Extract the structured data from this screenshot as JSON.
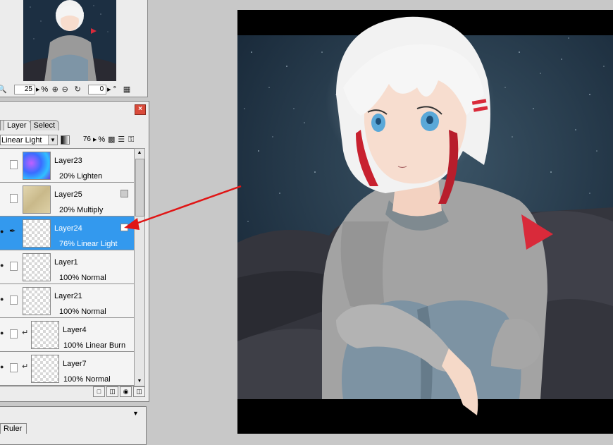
{
  "navigator": {
    "zoom_value": "25",
    "zoom_unit": "%",
    "rotation_value": "0",
    "rotation_unit": "°"
  },
  "layer_panel": {
    "tabs": [
      {
        "label": "Layer",
        "active": true
      },
      {
        "label": "Select",
        "active": false
      }
    ],
    "blend_mode": "Linear Light",
    "opacity_value": "76",
    "opacity_unit": "%",
    "layers": [
      {
        "name": "Layer23",
        "mode": "20% Lighten",
        "thumb": "galaxy",
        "visible": false,
        "selected": false,
        "clipped": false,
        "mask": false
      },
      {
        "name": "Layer25",
        "mode": "20% Multiply",
        "thumb": "paper",
        "visible": false,
        "selected": false,
        "clipped": false,
        "mask": true
      },
      {
        "name": "Layer24",
        "mode": "76% Linear Light",
        "thumb": "empty",
        "visible": true,
        "selected": true,
        "clipped": false,
        "mask": true
      },
      {
        "name": "Layer1",
        "mode": "100% Normal",
        "thumb": "empty",
        "visible": true,
        "selected": false,
        "clipped": false,
        "mask": false
      },
      {
        "name": "Layer21",
        "mode": "100% Normal",
        "thumb": "empty",
        "visible": true,
        "selected": false,
        "clipped": false,
        "mask": false
      },
      {
        "name": "Layer4",
        "mode": "100% Linear Burn",
        "thumb": "empty",
        "visible": true,
        "selected": false,
        "clipped": true,
        "mask": false
      },
      {
        "name": "Layer7",
        "mode": "100% Normal",
        "thumb": "empty",
        "visible": true,
        "selected": false,
        "clipped": true,
        "mask": false
      }
    ]
  },
  "ruler_panel": {
    "tab_label": "Ruler"
  },
  "colors": {
    "selected_row": "#3399ee",
    "arrow": "#e01515",
    "sky": "#1f3447",
    "hoodie": "#9c9c9c",
    "jeans": "#7d93a3",
    "hair": "#f4f4f4",
    "accent_red": "#d92a3a"
  }
}
